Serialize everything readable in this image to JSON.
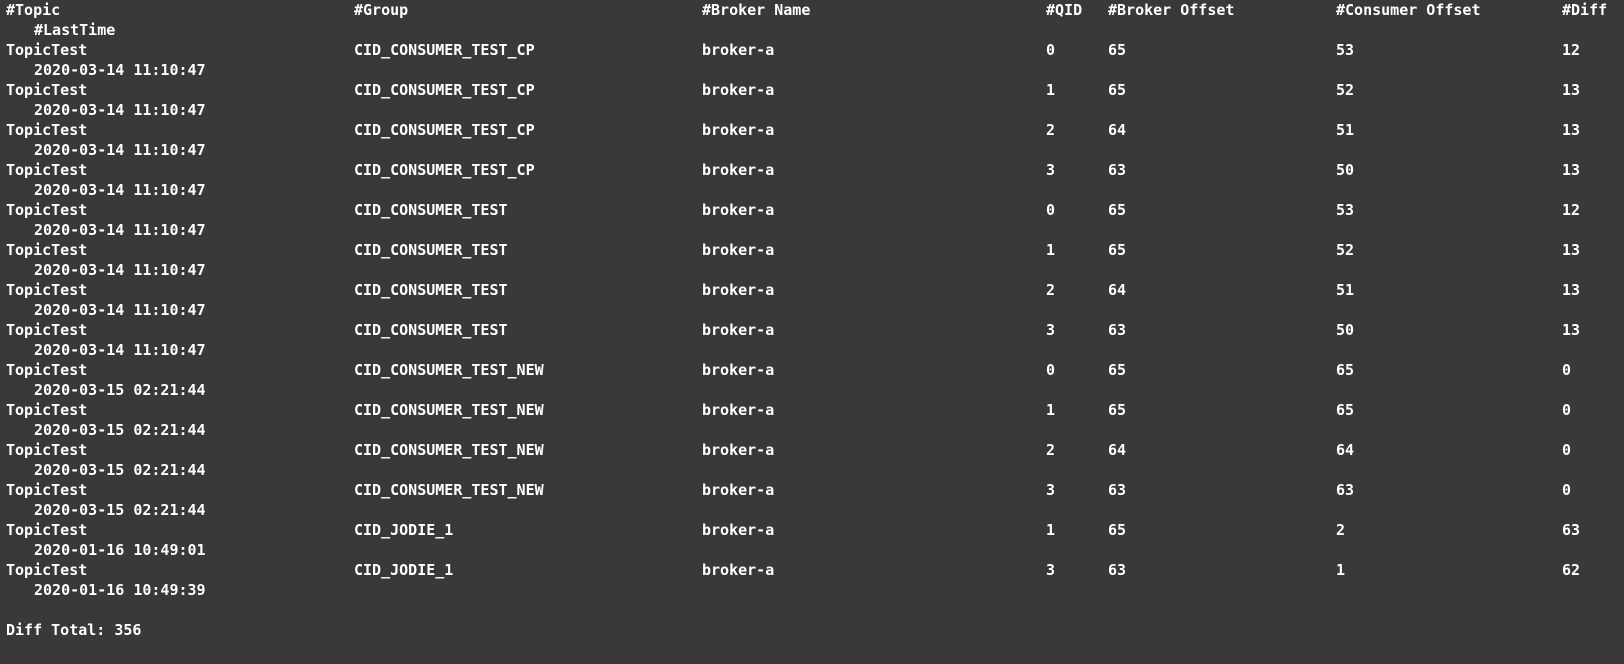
{
  "header": {
    "topic": "#Topic",
    "group": "#Group",
    "broker_name": "#Broker Name",
    "qid": "#QID",
    "broker_offset": "#Broker Offset",
    "consumer_offset": "#Consumer Offset",
    "diff": "#Diff",
    "last_time": "#LastTime"
  },
  "rows": [
    {
      "topic": "TopicTest",
      "group": "CID_CONSUMER_TEST_CP",
      "broker": "broker-a",
      "qid": "0",
      "broker_offset": "65",
      "consumer_offset": "53",
      "diff": "12",
      "last_time": "2020-03-14 11:10:47"
    },
    {
      "topic": "TopicTest",
      "group": "CID_CONSUMER_TEST_CP",
      "broker": "broker-a",
      "qid": "1",
      "broker_offset": "65",
      "consumer_offset": "52",
      "diff": "13",
      "last_time": "2020-03-14 11:10:47"
    },
    {
      "topic": "TopicTest",
      "group": "CID_CONSUMER_TEST_CP",
      "broker": "broker-a",
      "qid": "2",
      "broker_offset": "64",
      "consumer_offset": "51",
      "diff": "13",
      "last_time": "2020-03-14 11:10:47"
    },
    {
      "topic": "TopicTest",
      "group": "CID_CONSUMER_TEST_CP",
      "broker": "broker-a",
      "qid": "3",
      "broker_offset": "63",
      "consumer_offset": "50",
      "diff": "13",
      "last_time": "2020-03-14 11:10:47"
    },
    {
      "topic": "TopicTest",
      "group": "CID_CONSUMER_TEST",
      "broker": "broker-a",
      "qid": "0",
      "broker_offset": "65",
      "consumer_offset": "53",
      "diff": "12",
      "last_time": "2020-03-14 11:10:47"
    },
    {
      "topic": "TopicTest",
      "group": "CID_CONSUMER_TEST",
      "broker": "broker-a",
      "qid": "1",
      "broker_offset": "65",
      "consumer_offset": "52",
      "diff": "13",
      "last_time": "2020-03-14 11:10:47"
    },
    {
      "topic": "TopicTest",
      "group": "CID_CONSUMER_TEST",
      "broker": "broker-a",
      "qid": "2",
      "broker_offset": "64",
      "consumer_offset": "51",
      "diff": "13",
      "last_time": "2020-03-14 11:10:47"
    },
    {
      "topic": "TopicTest",
      "group": "CID_CONSUMER_TEST",
      "broker": "broker-a",
      "qid": "3",
      "broker_offset": "63",
      "consumer_offset": "50",
      "diff": "13",
      "last_time": "2020-03-14 11:10:47"
    },
    {
      "topic": "TopicTest",
      "group": "CID_CONSUMER_TEST_NEW",
      "broker": "broker-a",
      "qid": "0",
      "broker_offset": "65",
      "consumer_offset": "65",
      "diff": "0",
      "last_time": "2020-03-15 02:21:44"
    },
    {
      "topic": "TopicTest",
      "group": "CID_CONSUMER_TEST_NEW",
      "broker": "broker-a",
      "qid": "1",
      "broker_offset": "65",
      "consumer_offset": "65",
      "diff": "0",
      "last_time": "2020-03-15 02:21:44"
    },
    {
      "topic": "TopicTest",
      "group": "CID_CONSUMER_TEST_NEW",
      "broker": "broker-a",
      "qid": "2",
      "broker_offset": "64",
      "consumer_offset": "64",
      "diff": "0",
      "last_time": "2020-03-15 02:21:44"
    },
    {
      "topic": "TopicTest",
      "group": "CID_CONSUMER_TEST_NEW",
      "broker": "broker-a",
      "qid": "3",
      "broker_offset": "63",
      "consumer_offset": "63",
      "diff": "0",
      "last_time": "2020-03-15 02:21:44"
    },
    {
      "topic": "TopicTest",
      "group": "CID_JODIE_1",
      "broker": "broker-a",
      "qid": "1",
      "broker_offset": "65",
      "consumer_offset": "2",
      "diff": "63",
      "last_time": "2020-01-16 10:49:01"
    },
    {
      "topic": "TopicTest",
      "group": "CID_JODIE_1",
      "broker": "broker-a",
      "qid": "3",
      "broker_offset": "63",
      "consumer_offset": "1",
      "diff": "62",
      "last_time": "2020-01-16 10:49:39"
    }
  ],
  "footer": {
    "diff_total": "Diff Total: 356"
  },
  "colors": {
    "background": "#3a3838",
    "text": "#ffffff"
  }
}
